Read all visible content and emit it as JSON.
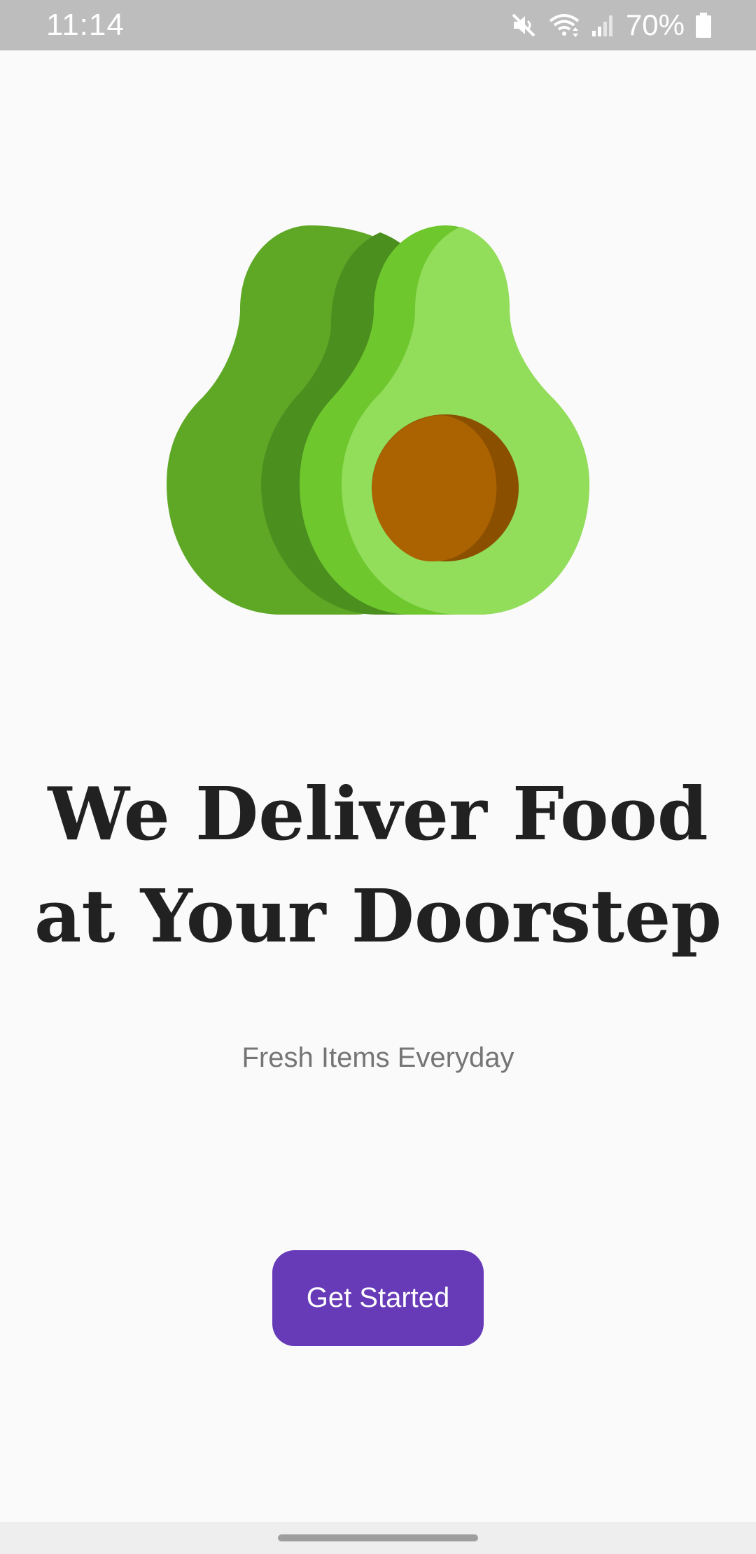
{
  "status_bar": {
    "time": "11:14",
    "battery_percent": "70%",
    "icons": [
      "mute-icon",
      "wifi-icon",
      "signal-icon",
      "battery-icon"
    ]
  },
  "hero": {
    "image": "avocado-illustration",
    "colors": {
      "back_dark": "#4b8f1f",
      "back_main": "#5ea826",
      "front_rim": "#6ec72d",
      "front_flesh": "#92dd5a",
      "seed_shadow": "#8b4f00",
      "seed": "#ab6302"
    }
  },
  "headline": {
    "line1": "We Deliver Food",
    "line2": "at Your Doorstep"
  },
  "subtitle": "Fresh Items Everyday",
  "cta": {
    "label": "Get Started",
    "color": "#673ab7"
  }
}
